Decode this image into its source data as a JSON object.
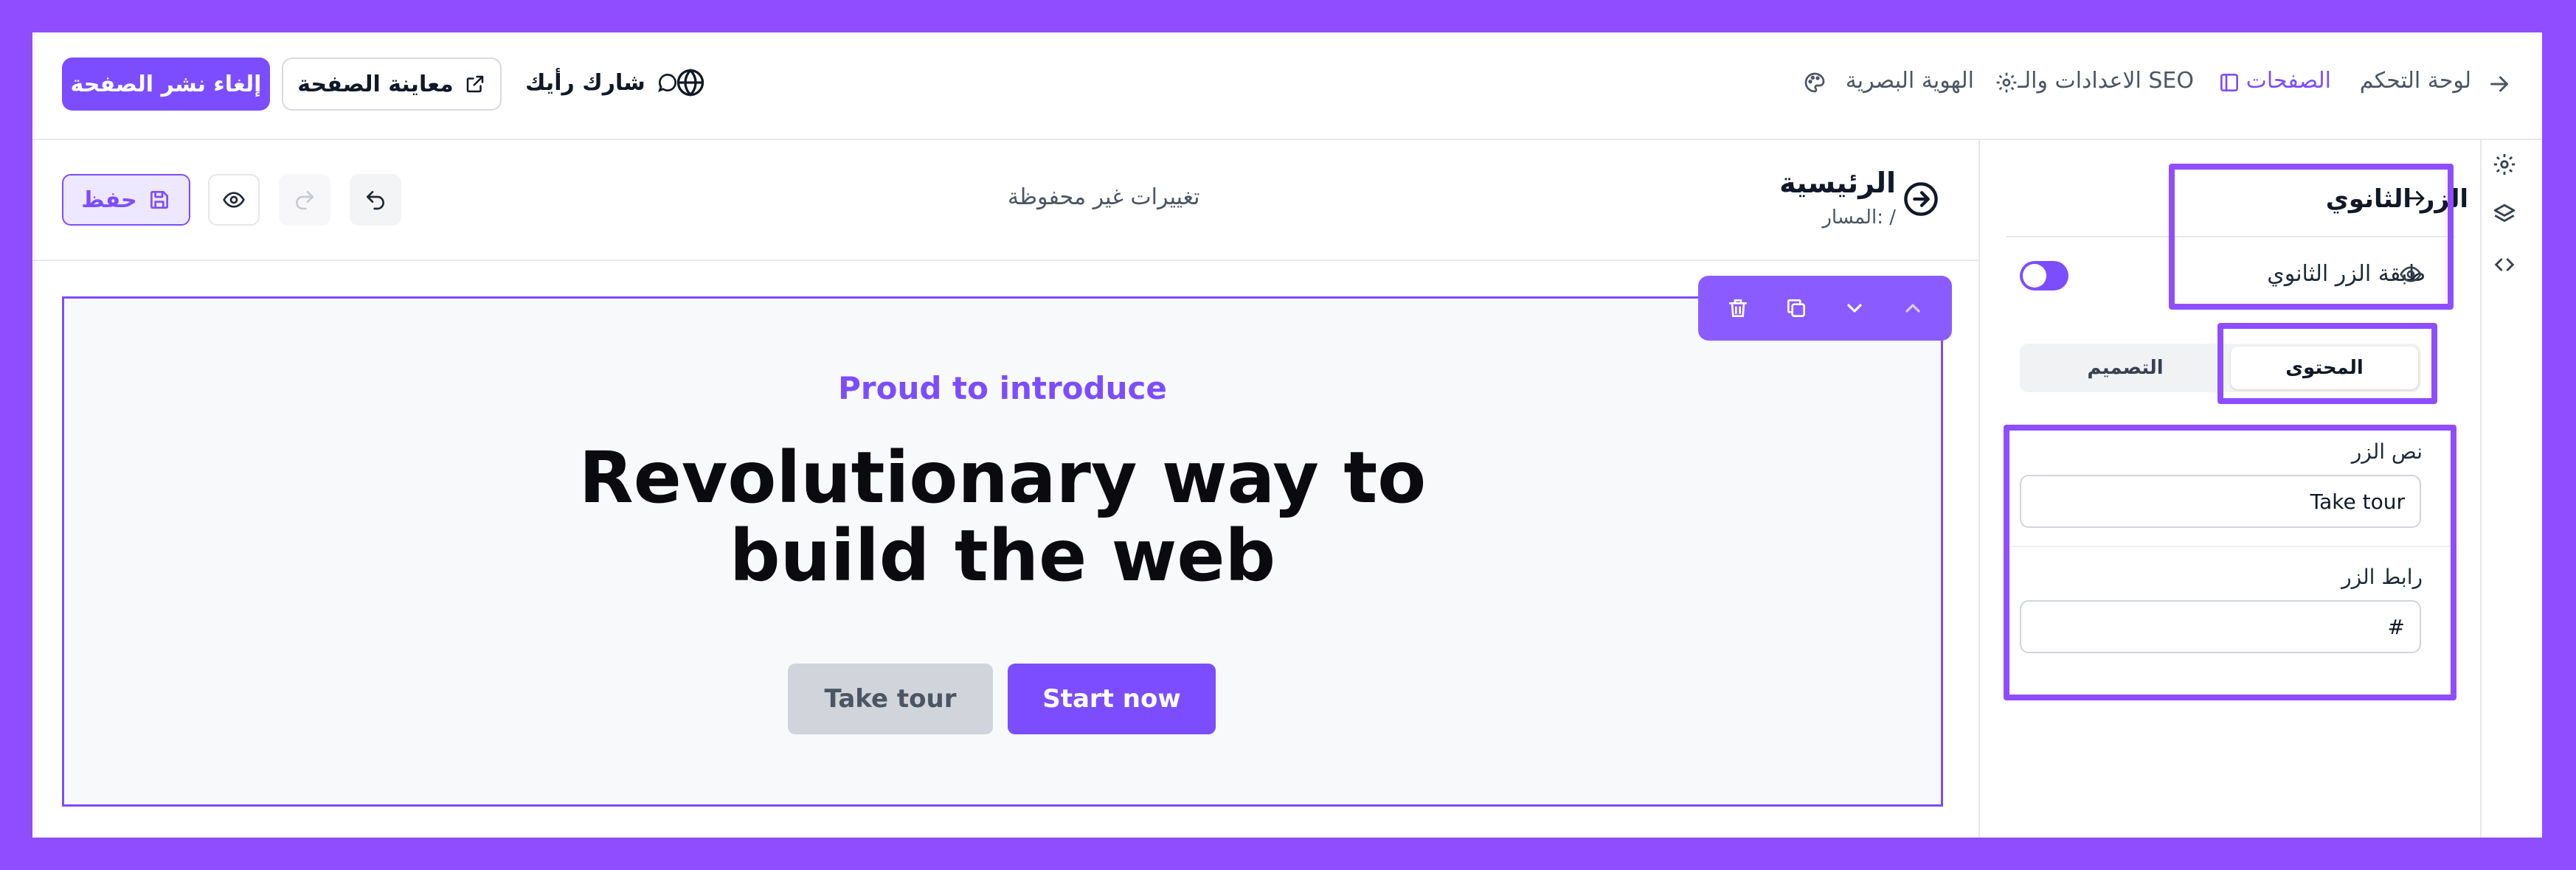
{
  "colors": {
    "brand": "#7c4dff",
    "frame": "#8f4dff",
    "canvas_bg": "#f8f9fb",
    "secondary_btn": "#d1d5db"
  },
  "top_nav": {
    "dashboard": "لوحة التحكم",
    "pages": "الصفحات",
    "settings_seo": "الاعدادات والـ SEO",
    "visual_identity": "الهوية البصرية",
    "feedback": "شارك رأيك",
    "preview_page": "معاينة الصفحة",
    "unpublish_page": "إلغاء نشر الصفحة"
  },
  "editor_header": {
    "page_title": "الرئيسية",
    "page_path": "المسار: /",
    "unsaved_status": "تغييرات غير محفوظة",
    "save_label": "حفظ"
  },
  "hero": {
    "eyebrow": "Proud to introduce",
    "headline_line1": "Revolutionary way to",
    "headline_line2": "build the web",
    "secondary_button": "Take tour",
    "primary_button": "Start now"
  },
  "panel": {
    "title": "الزر الثانوي",
    "layer_label": "طبقة الزر الثانوي",
    "layer_visible": false,
    "tab_content": "المحتوى",
    "tab_design": "التصميم",
    "active_tab": "المحتوى",
    "button_text_label": "نص الزر",
    "button_text_value": "Take tour",
    "button_link_label": "رابط الزر",
    "button_link_value": "#"
  },
  "icons": {
    "rail": [
      "gear-icon",
      "layers-icon",
      "code-icon"
    ],
    "block_toolbar": [
      "trash-icon",
      "duplicate-icon",
      "chevron-down-icon",
      "chevron-up-icon"
    ]
  }
}
